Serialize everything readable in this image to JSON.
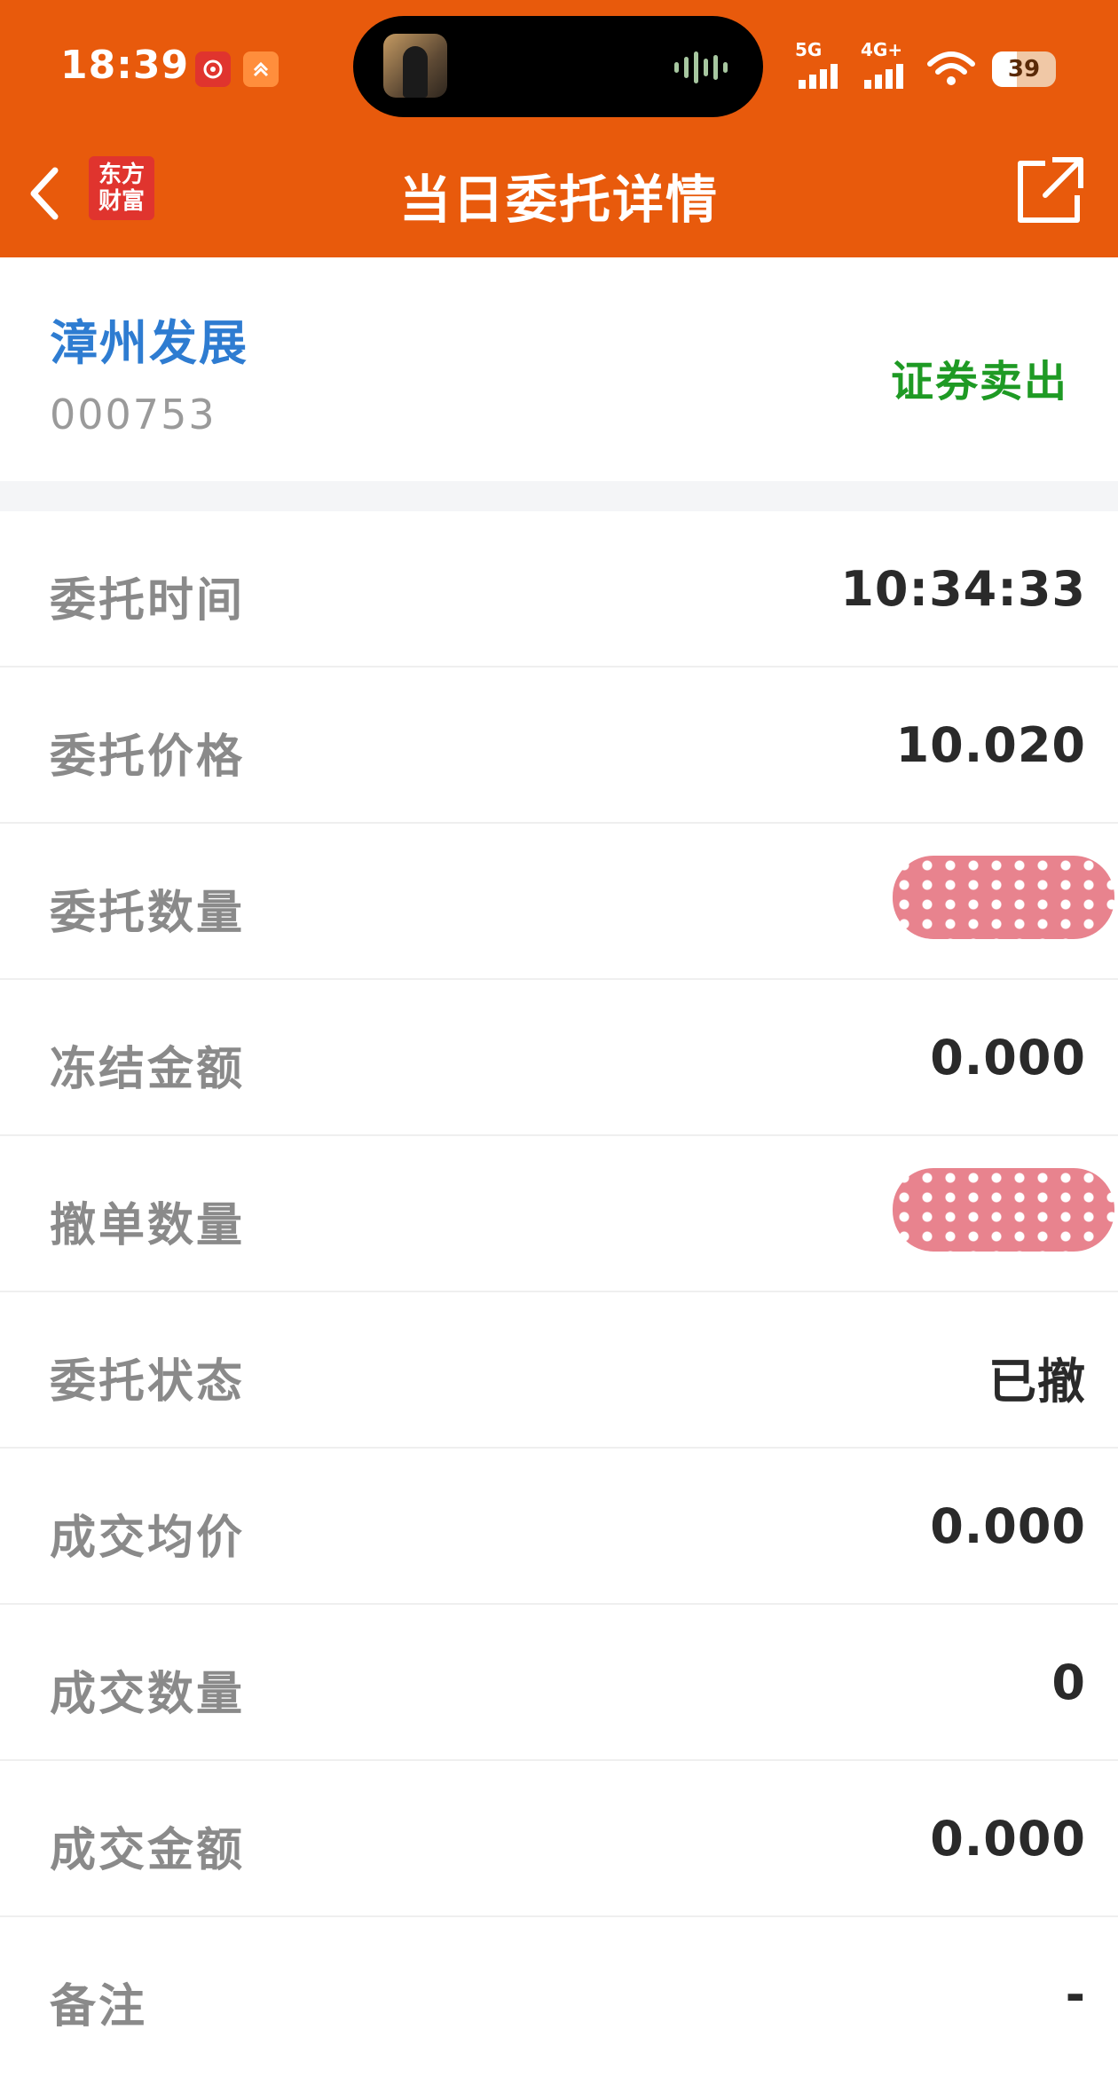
{
  "status_bar": {
    "time": "18:39",
    "network_labels": [
      "5G",
      "4G+"
    ],
    "battery": "39",
    "battery_level": 0.39
  },
  "nav": {
    "title": "当日委托详情",
    "logo_lines": [
      "东方",
      "财富"
    ],
    "back_icon": "chevron-left-icon",
    "share_icon": "share-external-icon"
  },
  "stock": {
    "name": "漳州发展",
    "code": "000753",
    "trade_type": "证券卖出"
  },
  "details": [
    {
      "label": "委托时间",
      "value": "10:34:33"
    },
    {
      "label": "委托价格",
      "value": "10.020"
    },
    {
      "label": "委托数量",
      "value": null,
      "redacted": true
    },
    {
      "label": "冻结金额",
      "value": "0.000"
    },
    {
      "label": "撤单数量",
      "value": null,
      "redacted": true
    },
    {
      "label": "委托状态",
      "value": "已撤"
    },
    {
      "label": "成交均价",
      "value": "0.000"
    },
    {
      "label": "成交数量",
      "value": "0"
    },
    {
      "label": "成交金额",
      "value": "0.000"
    },
    {
      "label": "备注",
      "value": "-"
    }
  ],
  "colors": {
    "header": "#E85A0C",
    "stock_name": "#2E7CD1",
    "trade_type": "#1E9A24",
    "label": "#8a8a8a",
    "value": "#2a2a2a",
    "redaction": "#E8838E"
  }
}
